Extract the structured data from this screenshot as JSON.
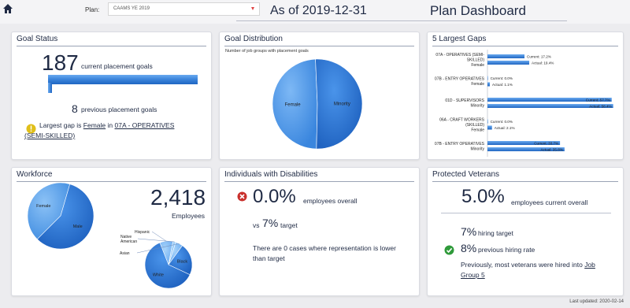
{
  "header": {
    "plan_label": "Plan:",
    "plan_value": "CAAMS YE 2019",
    "as_of": "As of 2019-12-31",
    "title": "Plan Dashboard"
  },
  "goal_status": {
    "title": "Goal Status",
    "current_count": "187",
    "current_label": "current placement goals",
    "current_bar_fraction": 1.0,
    "previous_count": "8",
    "previous_label": "previous placement goals",
    "gap_prefix": "Largest gap is",
    "gap_gender": "Female",
    "gap_in": "in",
    "gap_group_line1": "07A - OPERATIVES",
    "gap_group_line2": "(SEMI-SKILLED)"
  },
  "goal_distribution": {
    "title": "Goal Distribution",
    "subtitle": "Number of job groups with placement goals",
    "chart_data": {
      "type": "pie",
      "labels": [
        "Female",
        "Minority"
      ],
      "values": [
        49,
        51
      ]
    }
  },
  "largest_gaps": {
    "title": "5 Largest Gaps",
    "chart_data": {
      "type": "bar",
      "orientation": "horizontal",
      "groups": [
        {
          "label_lines": [
            "07A - OPERATIVES (SEMI-",
            "SKILLED)",
            "Female"
          ],
          "current": 17.2,
          "actual": 19.4,
          "current_label": "Current: 17.2%",
          "actual_label": "Actual: 19.4%"
        },
        {
          "label_lines": [
            "07B - ENTRY OPERATIVES",
            "Female"
          ],
          "current": 0.0,
          "actual": 1.1,
          "current_label": "Current: 0.0%",
          "actual_label": "Actual: 1.1%"
        },
        {
          "label_lines": [
            "01D - SUPERVISORS",
            "Minority"
          ],
          "current": 57.7,
          "actual": 58.4,
          "current_label": "Current: 57.7%",
          "actual_label": "Actual: 58.4%"
        },
        {
          "label_lines": [
            "06A - CRAFT WORKERS",
            "(SKILLED)",
            "Female"
          ],
          "current": 0.0,
          "actual": 2.1,
          "current_label": "Current: 0.0%",
          "actual_label": "Actual: 2.1%"
        },
        {
          "label_lines": [
            "07B - ENTRY OPERATIVES",
            "Minority"
          ],
          "current": 33.7,
          "actual": 35.8,
          "current_label": "Current: 33.7%",
          "actual_label": "Actual: 35.8%"
        }
      ],
      "xlim": [
        0,
        60
      ]
    }
  },
  "workforce": {
    "title": "Workforce",
    "count": "2,418",
    "count_label": "Employees",
    "gender_chart": {
      "type": "pie",
      "labels": [
        "Female",
        "Male"
      ],
      "values": [
        42,
        58
      ]
    },
    "race_chart": {
      "type": "pie",
      "labels": [
        "Hispanic",
        "Native American",
        "Asian",
        "Black",
        "White"
      ],
      "values": [
        9,
        2,
        5,
        22,
        62
      ]
    }
  },
  "disabilities": {
    "title": "Individuals with Disabilities",
    "overall_value": "0.0%",
    "overall_label": "employees overall",
    "vs_prefix": "vs",
    "target_value": "7%",
    "target_label": "target",
    "note_line1": "There are 0 cases where representation is lower",
    "note_line2": "than target"
  },
  "veterans": {
    "title": "Protected Veterans",
    "current_value": "5.0%",
    "current_label": "employees current overall",
    "hiring_target_value": "7%",
    "hiring_target_label": "hiring target",
    "previous_rate_value": "8%",
    "previous_rate_label": "previous hiring rate",
    "note_line1_prefix": "Previously, most veterans were hired into",
    "note_link_part1": "Job",
    "note_link_part2": "Group 5"
  },
  "footer": {
    "last_updated": "Last updated: 2020-02-14"
  },
  "colors": {
    "accent_blue": "#2a72d4",
    "warning_yellow": "#e0bf1a",
    "error_red": "#c9302c",
    "success_green": "#2f9a3a",
    "text_dark": "#1f2a44"
  }
}
